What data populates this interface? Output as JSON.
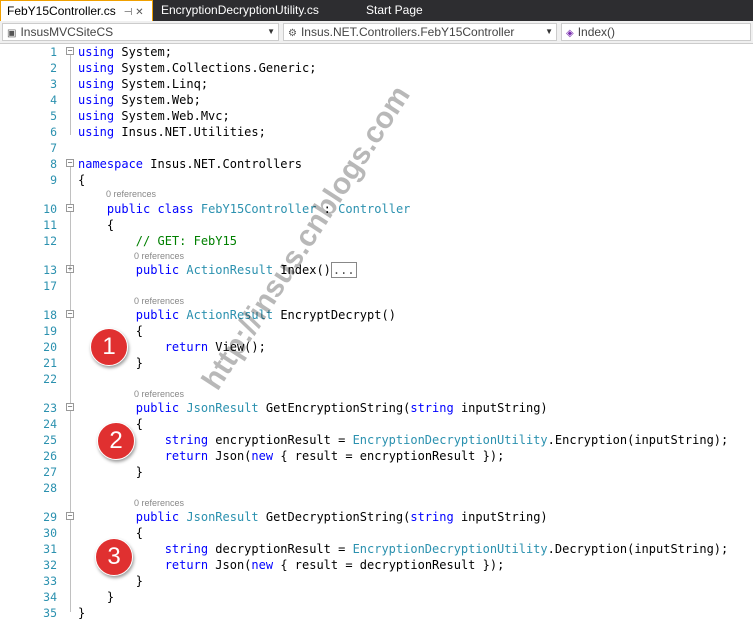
{
  "tabs": [
    {
      "label": "FebY15Controller.cs",
      "active": true,
      "icon": "pin-icon"
    },
    {
      "label": "EncryptionDecryptionUtility.cs",
      "active": false
    },
    {
      "label": "Start Page",
      "active": false
    }
  ],
  "navbar": {
    "project": "InsusMVCSiteCS",
    "class": "Insus.NET.Controllers.FebY15Controller",
    "member": "Index()"
  },
  "refs_label": "0 references",
  "lines": [
    {
      "n": "1",
      "html": "<span class='kw'>using</span> System;"
    },
    {
      "n": "2",
      "html": "<span class='kw'>using</span> System.Collections.Generic;"
    },
    {
      "n": "3",
      "html": "<span class='kw'>using</span> System.Linq;"
    },
    {
      "n": "4",
      "html": "<span class='kw'>using</span> System.Web;"
    },
    {
      "n": "5",
      "html": "<span class='kw'>using</span> System.Web.Mvc;"
    },
    {
      "n": "6",
      "html": "<span class='kw'>using</span> Insus.NET.Utilities;"
    },
    {
      "n": "7",
      "html": ""
    },
    {
      "n": "8",
      "html": "<span class='kw'>namespace</span> Insus.NET.Controllers"
    },
    {
      "n": "9",
      "html": "{"
    },
    {
      "n": "10",
      "html": "    <span class='kw'>public</span> <span class='kw'>class</span> <span class='ty'>FebY15Controller</span> : <span class='ty'>Controller</span>"
    },
    {
      "n": "11",
      "html": "    {"
    },
    {
      "n": "12",
      "html": "        <span class='cm'>// GET: FebY15</span>"
    },
    {
      "n": "13",
      "html": "        <span class='kw'>public</span> <span class='ty'>ActionResult</span> Index()<span class='collapsed'>...</span>"
    },
    {
      "n": "17",
      "html": ""
    },
    {
      "n": "18",
      "html": "        <span class='kw'>public</span> <span class='ty'>ActionResult</span> EncryptDecrypt()"
    },
    {
      "n": "19",
      "html": "        {"
    },
    {
      "n": "20",
      "html": "            <span class='kw'>return</span> View();"
    },
    {
      "n": "21",
      "html": "        }"
    },
    {
      "n": "22",
      "html": ""
    },
    {
      "n": "23",
      "html": "        <span class='kw'>public</span> <span class='ty'>JsonResult</span> GetEncryptionString(<span class='kw'>string</span> inputString)"
    },
    {
      "n": "24",
      "html": "        {"
    },
    {
      "n": "25",
      "html": "            <span class='kw'>string</span> encryptionResult = <span class='ty'>EncryptionDecryptionUtility</span>.Encryption(inputString);"
    },
    {
      "n": "26",
      "html": "            <span class='kw'>return</span> Json(<span class='kw'>new</span> { result = encryptionResult });"
    },
    {
      "n": "27",
      "html": "        }"
    },
    {
      "n": "28",
      "html": ""
    },
    {
      "n": "29",
      "html": "        <span class='kw'>public</span> <span class='ty'>JsonResult</span> GetDecryptionString(<span class='kw'>string</span> inputString)"
    },
    {
      "n": "30",
      "html": "        {"
    },
    {
      "n": "31",
      "html": "            <span class='kw'>string</span> decryptionResult = <span class='ty'>EncryptionDecryptionUtility</span>.Decryption(inputString);"
    },
    {
      "n": "32",
      "html": "            <span class='kw'>return</span> Json(<span class='kw'>new</span> { result = decryptionResult });"
    },
    {
      "n": "33",
      "html": "        }"
    },
    {
      "n": "34",
      "html": "    }"
    },
    {
      "n": "35",
      "html": "}"
    }
  ],
  "badges": [
    "1",
    "2",
    "3"
  ],
  "watermark": "http://insus.cnblogs.com",
  "colors": {
    "keyword": "#0000ff",
    "type": "#2b91af",
    "comment": "#008000",
    "badge": "#e03030",
    "tab_active_border": "#f0a000"
  }
}
